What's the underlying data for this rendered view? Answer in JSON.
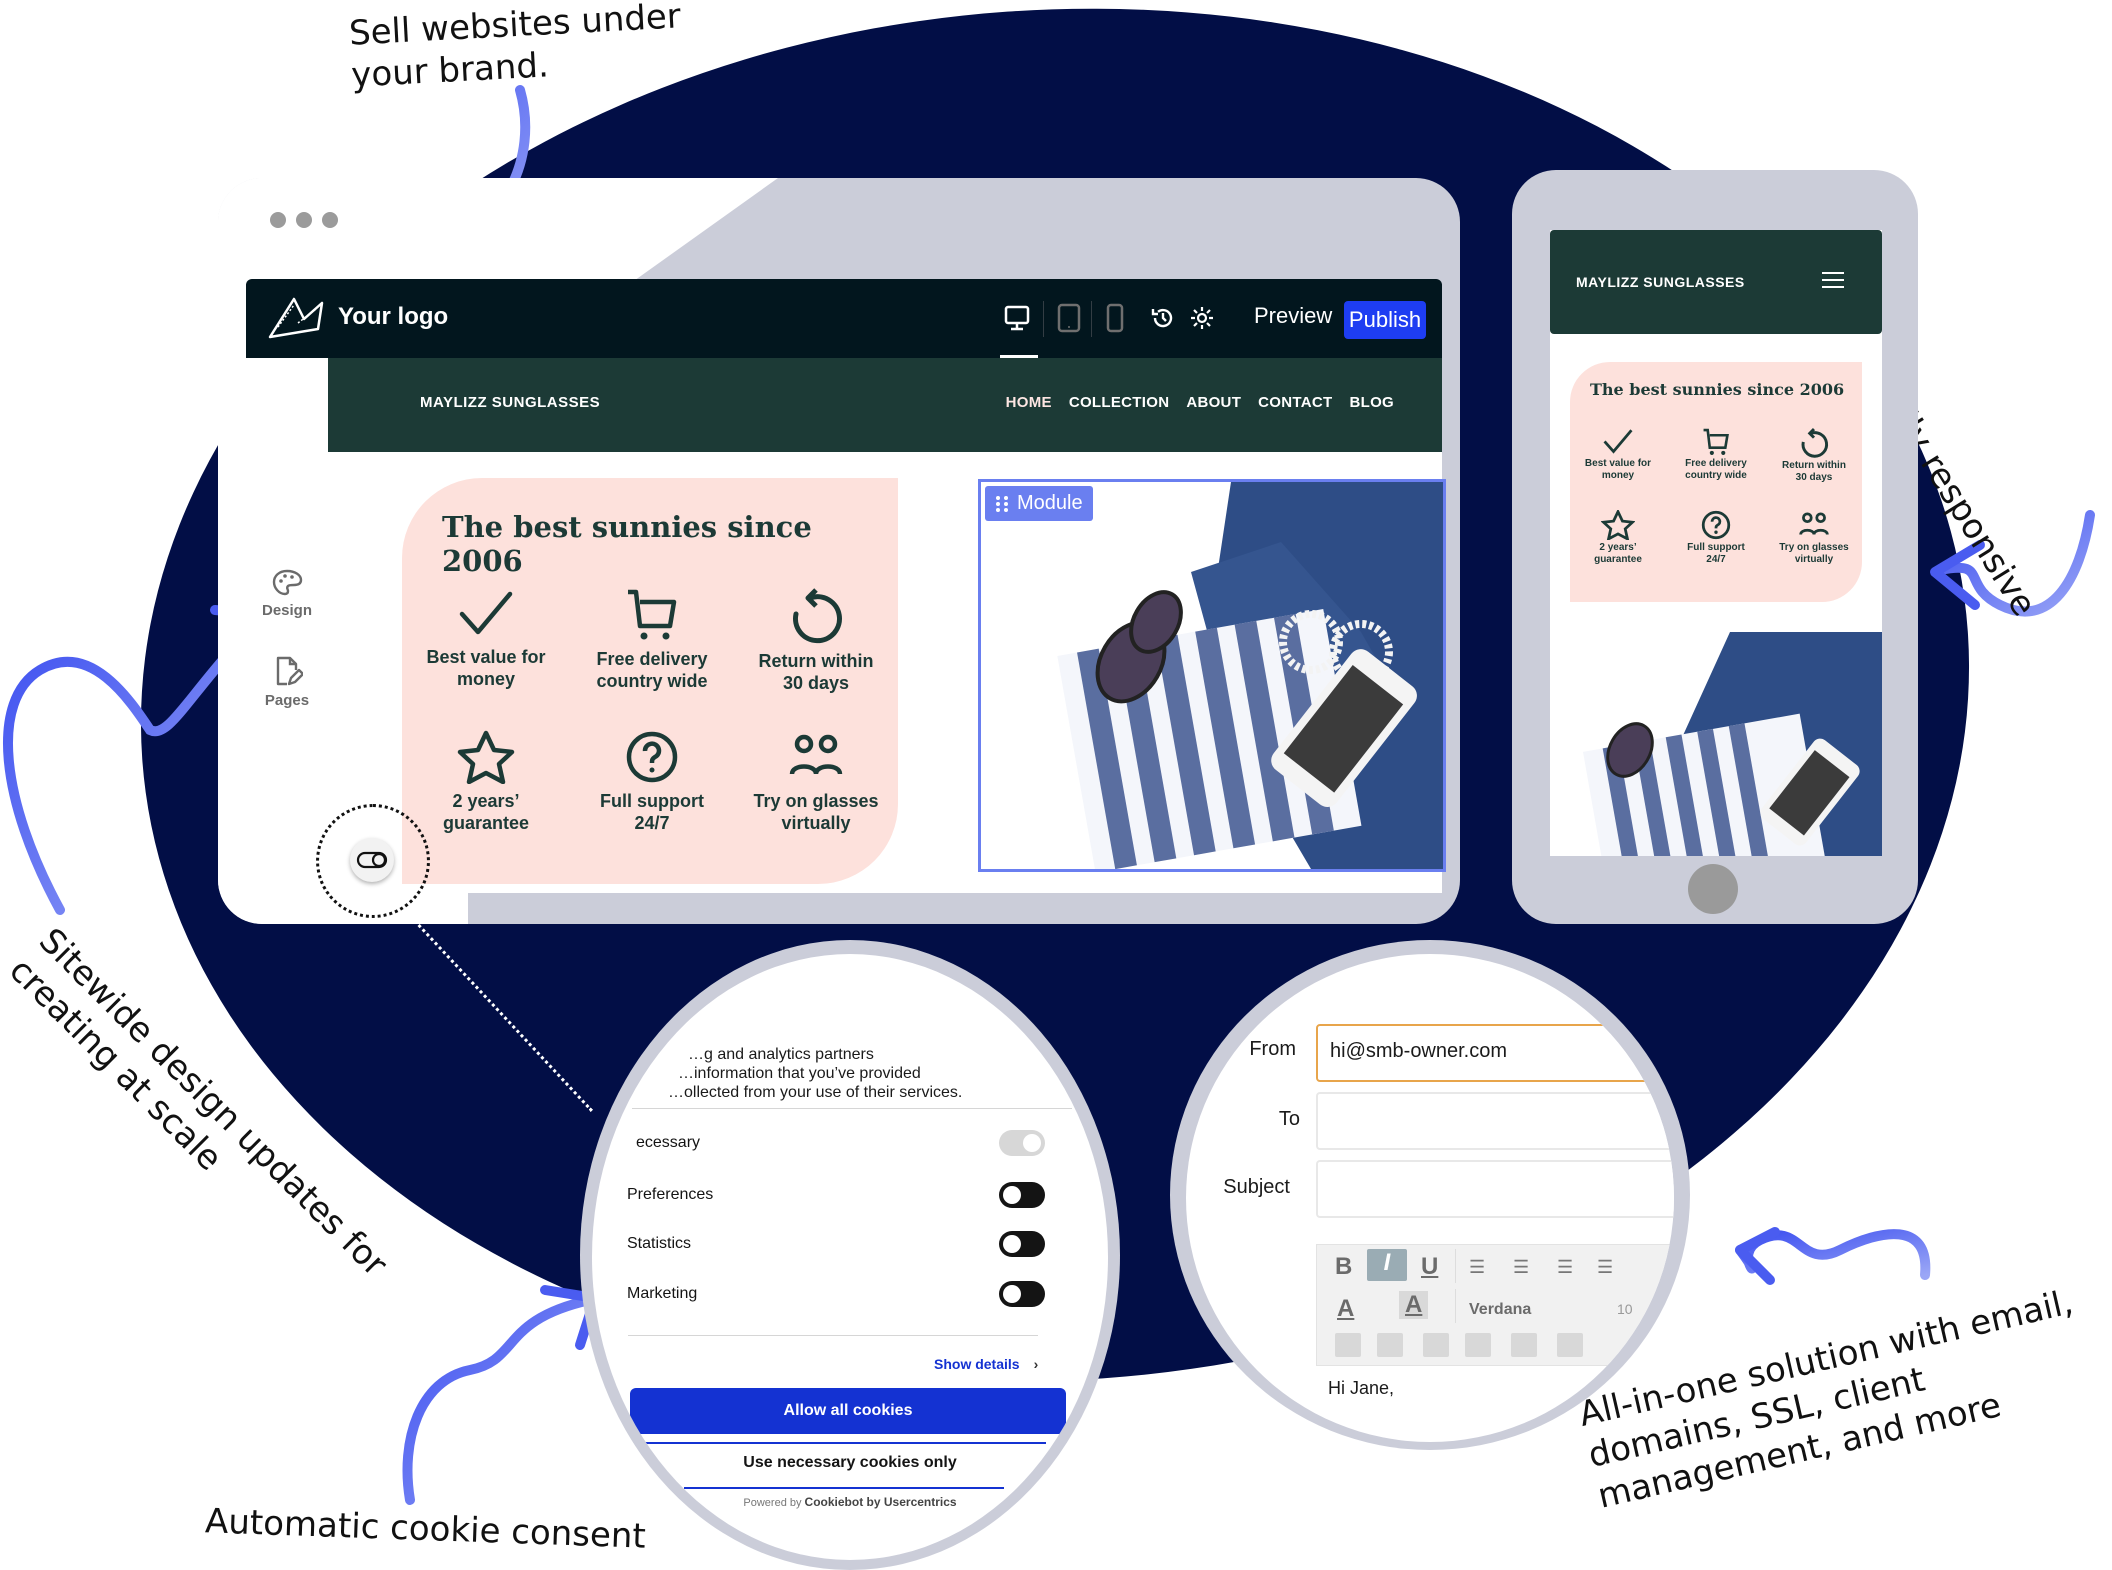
{
  "annotations": {
    "brand": [
      "Sell websites under",
      "your brand."
    ],
    "responsive": "Fully responsive",
    "sitewide": [
      "Sitewide design updates for",
      "creating at scale"
    ],
    "cookie": "Automatic cookie consent",
    "allinone": [
      "All-in-one solution with email,",
      "domains, SSL, client",
      "management, and more"
    ]
  },
  "editor": {
    "logo_text": "Your logo",
    "devices": [
      "desktop-icon",
      "tablet-icon",
      "mobile-icon"
    ],
    "active_device": "desktop",
    "preview_label": "Preview",
    "publish_label": "Publish",
    "sidebar": [
      {
        "label": "Design",
        "icon": "palette-icon"
      },
      {
        "label": "Pages",
        "icon": "page-edit-icon"
      }
    ],
    "module_label": "Module"
  },
  "site": {
    "brand": "MAYLIZZ SUNGLASSES",
    "menu": [
      "HOME",
      "COLLECTION",
      "ABOUT",
      "CONTACT",
      "BLOG"
    ],
    "active_menu": "HOME",
    "card_title": "The best sunnies since 2006",
    "features": [
      {
        "icon": "check-icon",
        "label": [
          "Best value for",
          "money"
        ]
      },
      {
        "icon": "cart-icon",
        "label": [
          "Free delivery",
          "country wide"
        ]
      },
      {
        "icon": "return-icon",
        "label": [
          "Return within",
          "30 days"
        ]
      },
      {
        "icon": "star-icon",
        "label": [
          "2 years’",
          "guarantee"
        ]
      },
      {
        "icon": "help-icon",
        "label": [
          "Full support",
          "24/7"
        ]
      },
      {
        "icon": "people-icon",
        "label": [
          "Try on glasses",
          "virtually"
        ]
      }
    ]
  },
  "cookie": {
    "intro": [
      "…g and analytics partners",
      "…information that you’ve provided",
      "…ollected from your use of their services."
    ],
    "categories": [
      {
        "label": "Necessary",
        "visible_label": "ecessary",
        "enabled": true,
        "disabled": true
      },
      {
        "label": "Preferences",
        "enabled": false
      },
      {
        "label": "Statistics",
        "enabled": false
      },
      {
        "label": "Marketing",
        "enabled": false
      }
    ],
    "show_details": "Show details",
    "allow_all": "Allow all cookies",
    "necessary_only": "Use necessary cookies only",
    "powered_prefix": "Powered by",
    "powered_brand": "Cookiebot by Usercentrics"
  },
  "email": {
    "from_label": "From",
    "from_value": "hi@smb-owner.com",
    "to_label": "To",
    "to_value": "",
    "subject_label": "Subject",
    "subject_value": "",
    "toolbar": {
      "bold": "B",
      "italic": "I",
      "underline": "U",
      "font_color": "A",
      "highlight": "A",
      "font": "Verdana",
      "size": "10"
    },
    "body": "Hi Jane,"
  },
  "colors": {
    "navy": "#020e46",
    "frame": "#cbcdd9",
    "editor_bar": "#02161e",
    "publish": "#1e3df2",
    "site_green": "#1c3a36",
    "card_pink": "#fde1dc",
    "module_blue": "#6a7ff0",
    "cookie_blue": "#1432d2",
    "arrow_blue": "#4a5cf0",
    "email_focus": "#e8a54b"
  }
}
